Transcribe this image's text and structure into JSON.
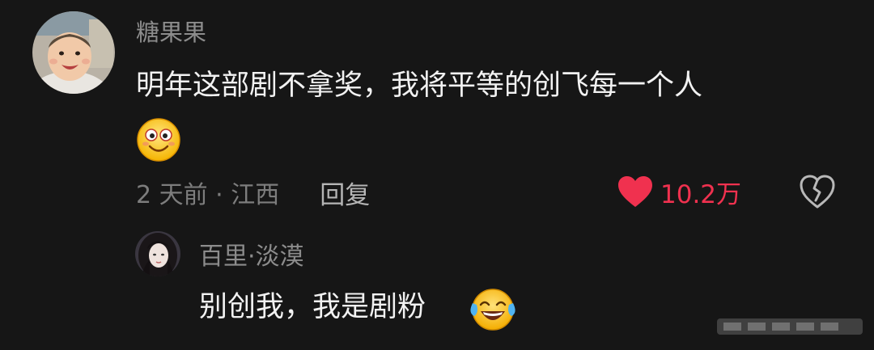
{
  "comment": {
    "username": "糖果果",
    "text": "明年这部剧不拿奖，我将平等的创飞每一个人",
    "emoji": "smiling-face-emoji",
    "time_location": "2 天前 · 江西",
    "reply_label": "回复",
    "like_count": "10.2万",
    "like_icon": "heart-icon",
    "dislike_icon": "broken-heart-icon"
  },
  "reply": {
    "username": "百里·淡漠",
    "text": "别创我，我是剧粉",
    "emoji": "tears-of-joy-emoji"
  },
  "colors": {
    "background": "#161616",
    "like_red": "#f0314f",
    "username_gray": "#8c8c8c",
    "text_white": "#f2f2f2"
  }
}
